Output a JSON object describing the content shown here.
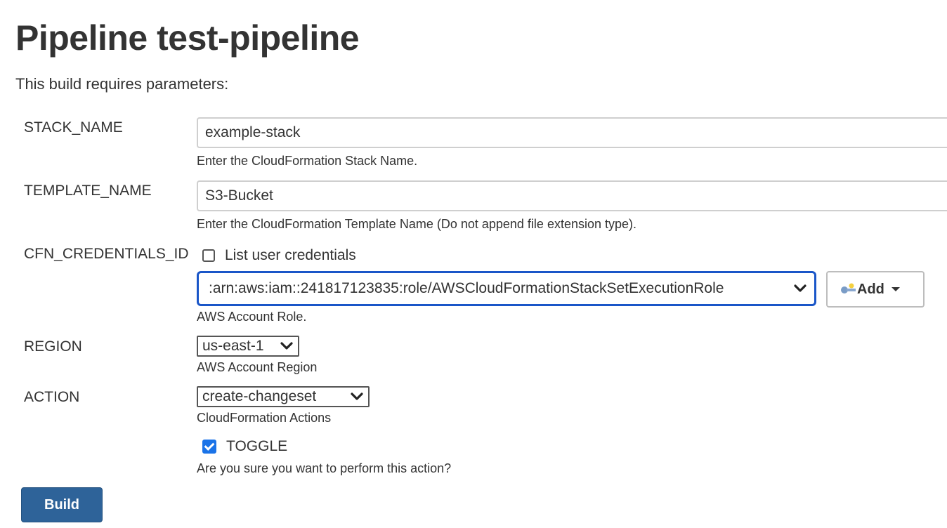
{
  "page_title": "Pipeline test-pipeline",
  "intro_text": "This build requires parameters:",
  "params": {
    "stack_name": {
      "label": "STACK_NAME",
      "value": "example-stack",
      "description": "Enter the CloudFormation Stack Name."
    },
    "template_name": {
      "label": "TEMPLATE_NAME",
      "value": "S3-Bucket",
      "description": "Enter the CloudFormation Template Name (Do not append file extension type)."
    },
    "cfn_credentials_id": {
      "label": "CFN_CREDENTIALS_ID",
      "list_user_credentials_label": "List user credentials",
      "list_user_credentials_checked": false,
      "selected_value": ":arn:aws:iam::241817123835:role/AWSCloudFormationStackSetExecutionRole",
      "add_button_label": "Add",
      "description": "AWS Account Role."
    },
    "region": {
      "label": "REGION",
      "selected_value": "us-east-1",
      "description": "AWS Account Region"
    },
    "action": {
      "label": "ACTION",
      "selected_value": "create-changeset",
      "description": "CloudFormation Actions"
    },
    "toggle": {
      "label": "TOGGLE",
      "checked": true,
      "description": "Are you sure you want to perform this action?"
    }
  },
  "build_button_label": "Build",
  "colors": {
    "focus_border": "#1a56c8",
    "checkbox_checked": "#1a73e8",
    "build_button": "#2e6399"
  }
}
